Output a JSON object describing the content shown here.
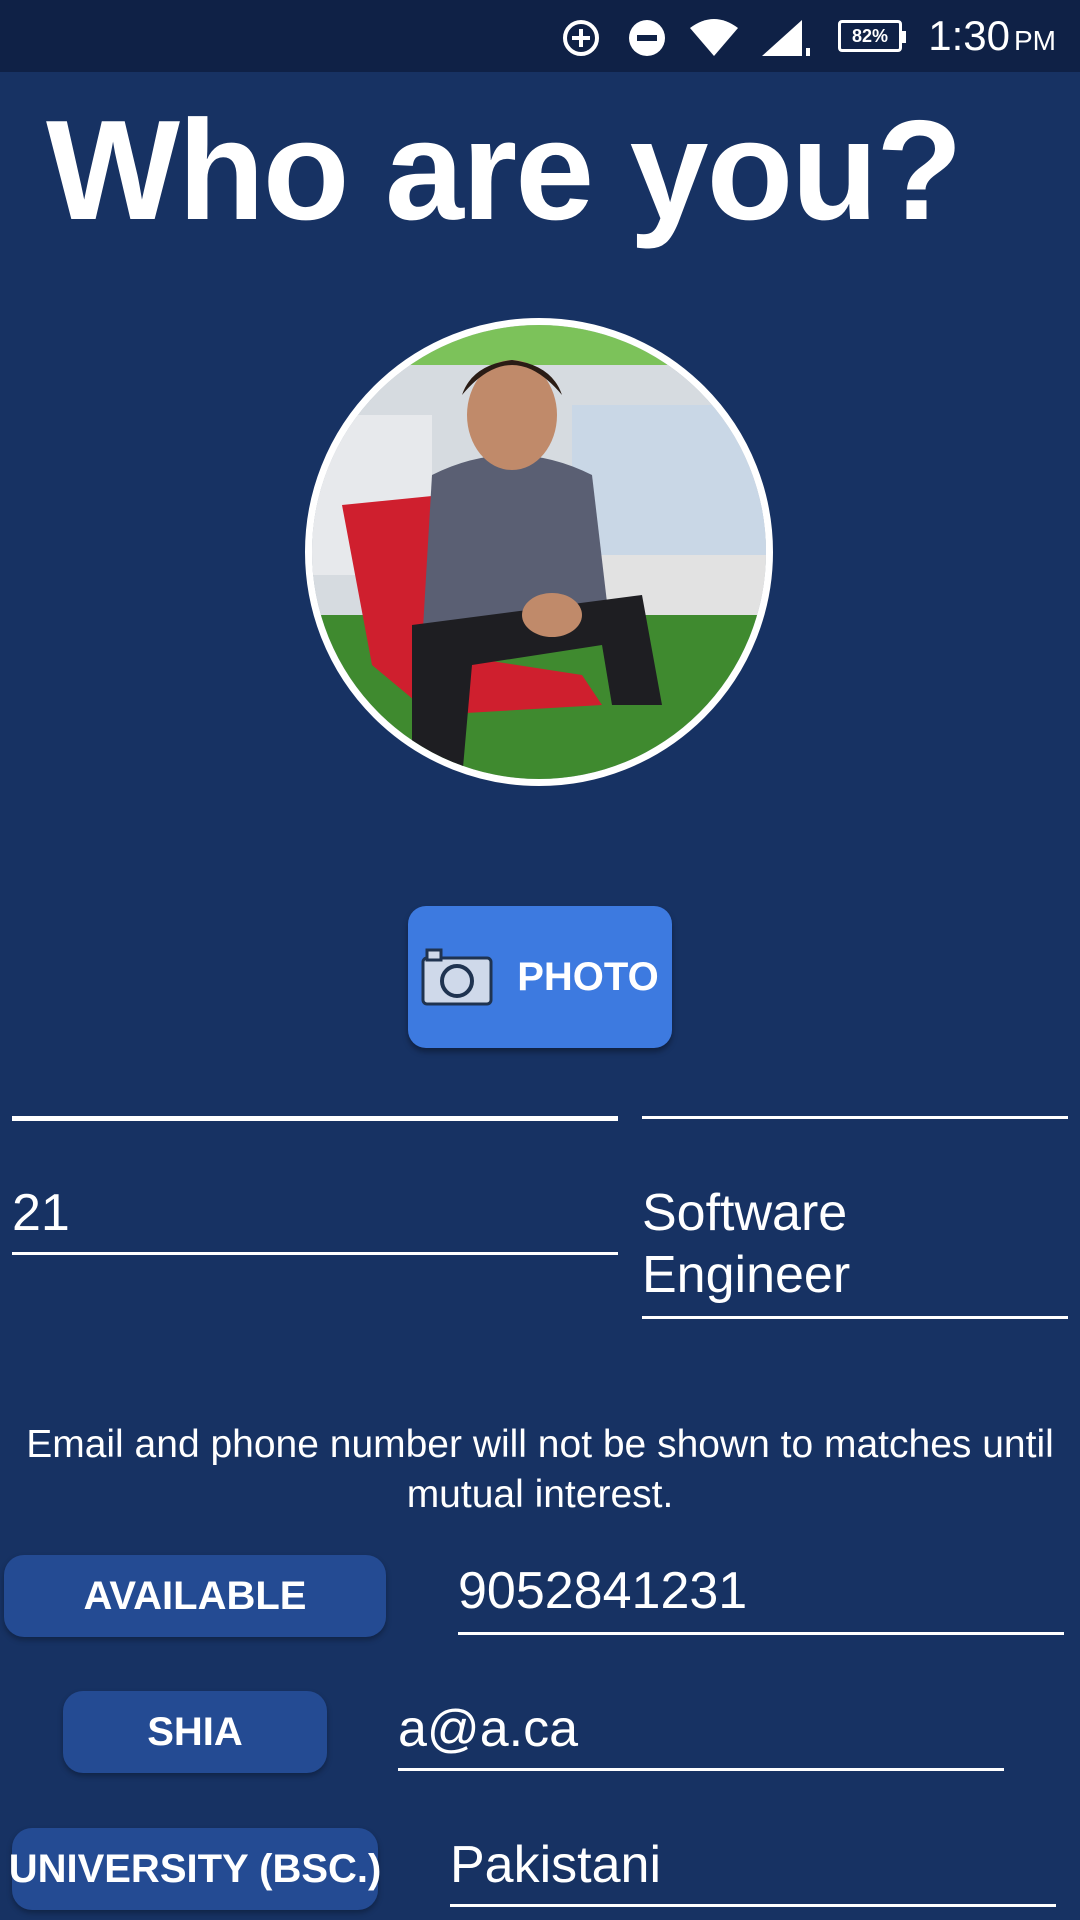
{
  "status_bar": {
    "time": "1:30",
    "ampm": "PM",
    "battery": "82%",
    "icons": [
      "data-saver-icon",
      "do-not-disturb-icon",
      "wifi-icon",
      "cell-signal-icon",
      "battery-icon"
    ]
  },
  "page": {
    "title": "Who are you?"
  },
  "profile": {
    "avatar_alt": "profile-photo",
    "photo_button_label": "PHOTO",
    "photo_icon": "camera-icon"
  },
  "fields": {
    "name_value": "",
    "other_value": "",
    "age_value": "21",
    "occupation_value": "Software Engineer",
    "phone_value": "9052841231",
    "email_value": "a@a.ca",
    "ethnicity_value": "Pakistani"
  },
  "privacy_note": "Email and phone number will not be shown to matches until mutual interest.",
  "buttons": {
    "status": "AVAILABLE",
    "sect": "SHIA",
    "education": "UNIVERSITY (BSC.)"
  },
  "colors": {
    "background": "#173263",
    "status_bar": "#0f2146",
    "photo_button": "#3d7ae0",
    "pill_button": "#244b93"
  }
}
